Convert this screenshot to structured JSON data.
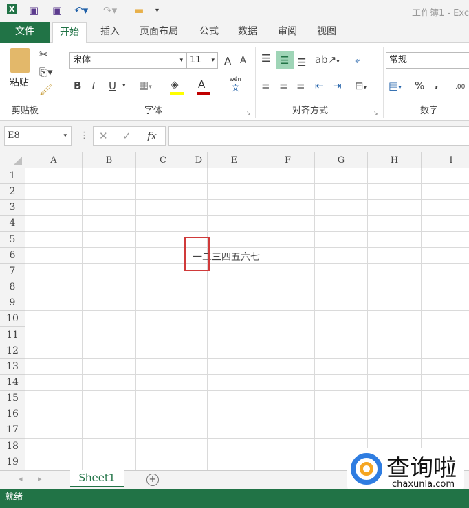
{
  "titlebar": {
    "title": "工作簿1 - Exc",
    "icons": [
      "excel-logo-icon",
      "save-icon",
      "save-as-icon",
      "undo-icon",
      "redo-icon",
      "open-folder-icon",
      "customize-icon"
    ]
  },
  "tabs": [
    "文件",
    "开始",
    "插入",
    "页面布局",
    "公式",
    "数据",
    "审阅",
    "视图"
  ],
  "ribbon": {
    "clipboard": {
      "paste": "粘贴",
      "group": "剪贴板"
    },
    "font": {
      "name": "宋体",
      "size": "11",
      "bold": "B",
      "italic": "I",
      "underline": "U",
      "phonetic": "文",
      "phonetic_top": "wén",
      "grow": "A",
      "shrink": "A",
      "color": "A",
      "group": "字体",
      "fill_color": "#ffff00",
      "font_color": "#c00000"
    },
    "alignment": {
      "group": "对齐方式"
    },
    "number": {
      "format": "常规",
      "percent": "%",
      "comma": ",",
      "increase_decimal": ".00",
      "group": "数字"
    }
  },
  "formula_bar": {
    "name_box": "E8",
    "fx": "fx",
    "cancel": "✕",
    "enter": "✓",
    "value": ""
  },
  "columns": [
    "A",
    "B",
    "C",
    "D",
    "E",
    "F",
    "G",
    "H",
    "I"
  ],
  "rows": [
    "1",
    "2",
    "3",
    "4",
    "5",
    "6",
    "7",
    "8",
    "9",
    "10",
    "11",
    "12",
    "13",
    "14",
    "15",
    "16",
    "17",
    "18",
    "19"
  ],
  "cells": {
    "D6": "一二三四五六七"
  },
  "sheets": {
    "tabs": [
      "Sheet1"
    ],
    "active": "Sheet1",
    "add": "+"
  },
  "status": {
    "text": "就绪"
  },
  "watermark": {
    "text": "查询啦",
    "url": "chaxunla.com"
  }
}
